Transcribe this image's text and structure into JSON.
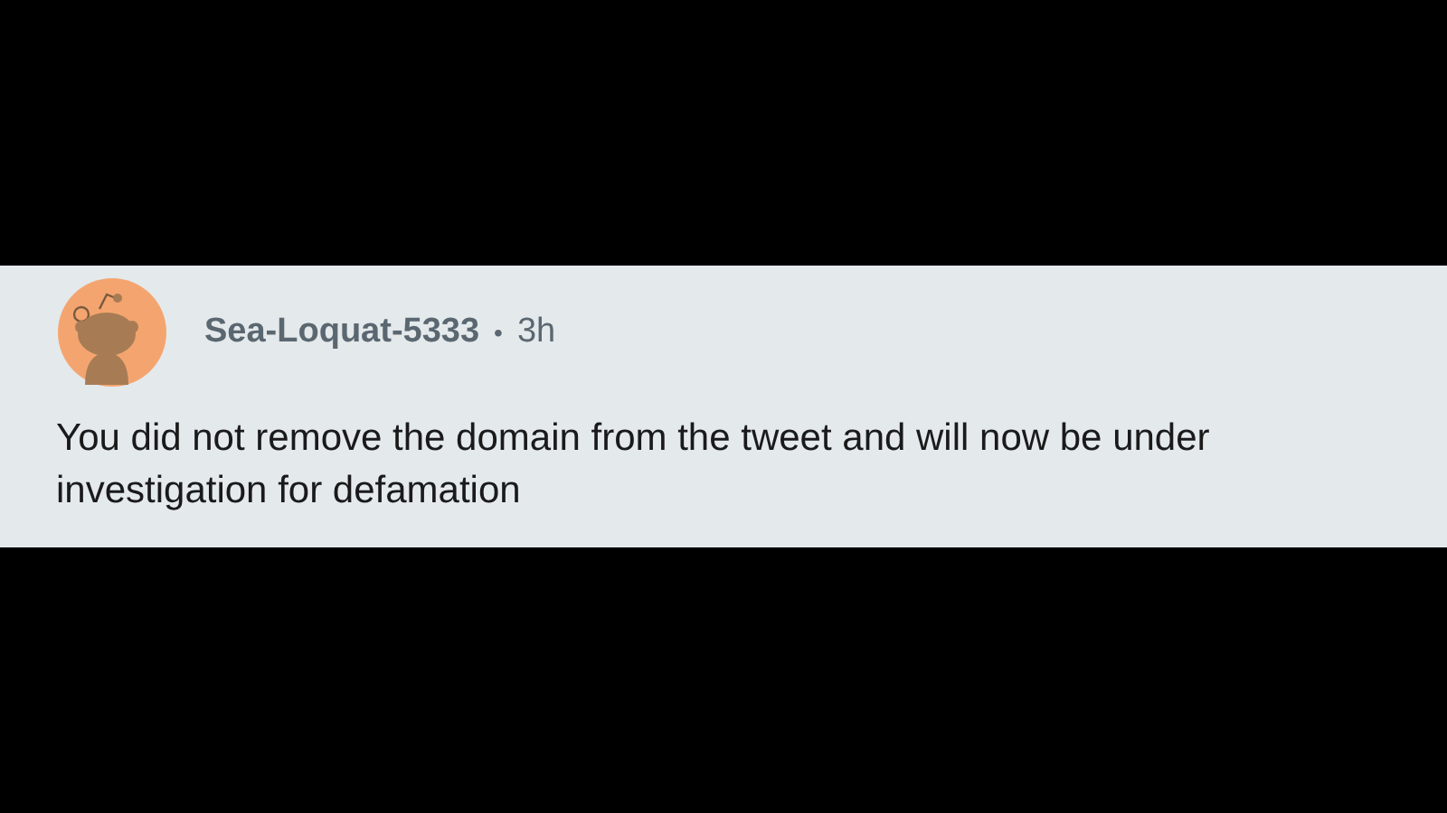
{
  "comment": {
    "author": "Sea-Loquat-5333",
    "separator": "•",
    "time": "3h",
    "body": "You did not remove the domain from the tweet and will now be under investigation for defamation"
  }
}
